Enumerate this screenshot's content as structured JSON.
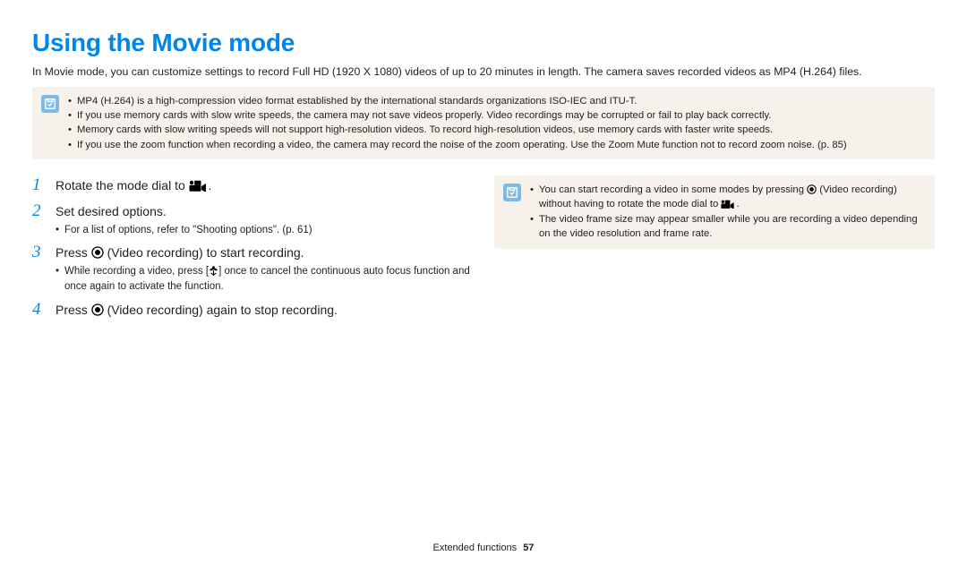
{
  "title": "Using the Movie mode",
  "intro": "In Movie mode, you can customize settings to record Full HD (1920 X 1080) videos of up to 20 minutes in length. The camera saves recorded videos as MP4 (H.264) files.",
  "top_notes": [
    "MP4 (H.264) is a high-compression video format established by the international standards organizations ISO-IEC and ITU-T.",
    "If you use memory cards with slow write speeds, the camera may not save videos properly. Video recordings may be corrupted or fail to play back correctly.",
    "Memory cards with slow writing speeds will not support high-resolution videos. To record high-resolution videos, use memory cards with faster write speeds.",
    "If you use the zoom function when recording a video, the camera may record the noise of the zoom operating. Use the Zoom Mute function not to record zoom noise. (p. 85)"
  ],
  "steps": {
    "s1": {
      "pre": "Rotate the mode dial to ",
      "post": "."
    },
    "s2": {
      "main": "Set desired options.",
      "sub": "For a list of options, refer to \"Shooting options\". (p. 61)"
    },
    "s3": {
      "pre": "Press ",
      "mid": " (Video recording) to start recording.",
      "sub_pre": "While recording a video, press [",
      "sub_post": "] once to cancel the continuous auto focus function and once again to activate the function."
    },
    "s4": {
      "pre": "Press ",
      "mid": " (Video recording) again to stop recording."
    }
  },
  "right_notes": {
    "n1_pre": "You can start recording a video in some modes by pressing ",
    "n1_mid": " (Video recording) without having to rotate the mode dial to ",
    "n1_post": ".",
    "n2": "The video frame size may appear smaller while you are recording a video depending on the video resolution and frame rate."
  },
  "footer": {
    "section": "Extended functions",
    "page": "57"
  },
  "icons": {
    "movie": "movie-mode-icon",
    "record": "record-button-icon",
    "macro": "macro-flower-icon",
    "note": "note-icon"
  }
}
